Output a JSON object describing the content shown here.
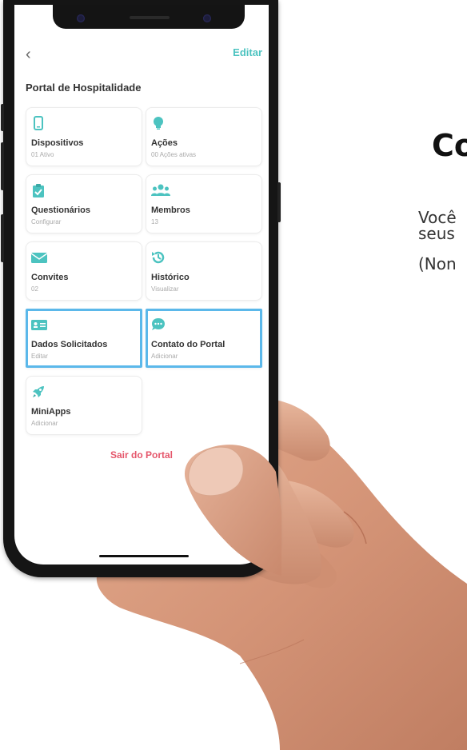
{
  "app": {
    "edit_label": "Editar",
    "title": "Portal de Hospitalidade",
    "cards": [
      {
        "label": "Dispositivos",
        "sub": "01 Ativo",
        "icon": "phone-icon"
      },
      {
        "label": "Ações",
        "sub": "00 Ações ativas",
        "icon": "lightbulb-icon"
      },
      {
        "label": "Questionários",
        "sub": "Configurar",
        "icon": "clipboard-check-icon"
      },
      {
        "label": "Membros",
        "sub": "13",
        "icon": "users-icon"
      },
      {
        "label": "Convites",
        "sub": "02",
        "icon": "envelope-icon"
      },
      {
        "label": "Histórico",
        "sub": "Visualizar",
        "icon": "history-icon"
      },
      {
        "label": "Dados Solicitados",
        "sub": "Editar",
        "icon": "id-card-icon"
      },
      {
        "label": "Contato do Portal",
        "sub": "Adicionar",
        "icon": "chat-bubble-icon"
      },
      {
        "label": "MiniApps",
        "sub": "Adicionar",
        "icon": "rocket-icon"
      }
    ],
    "logout_label": "Sair do Portal"
  },
  "side": {
    "heading": "Co",
    "line1": "Você",
    "line2": "seus",
    "line3": "(Non"
  },
  "colors": {
    "accent": "#4cc3c0",
    "highlight": "#5bb8ea",
    "logout": "#e5566b"
  }
}
